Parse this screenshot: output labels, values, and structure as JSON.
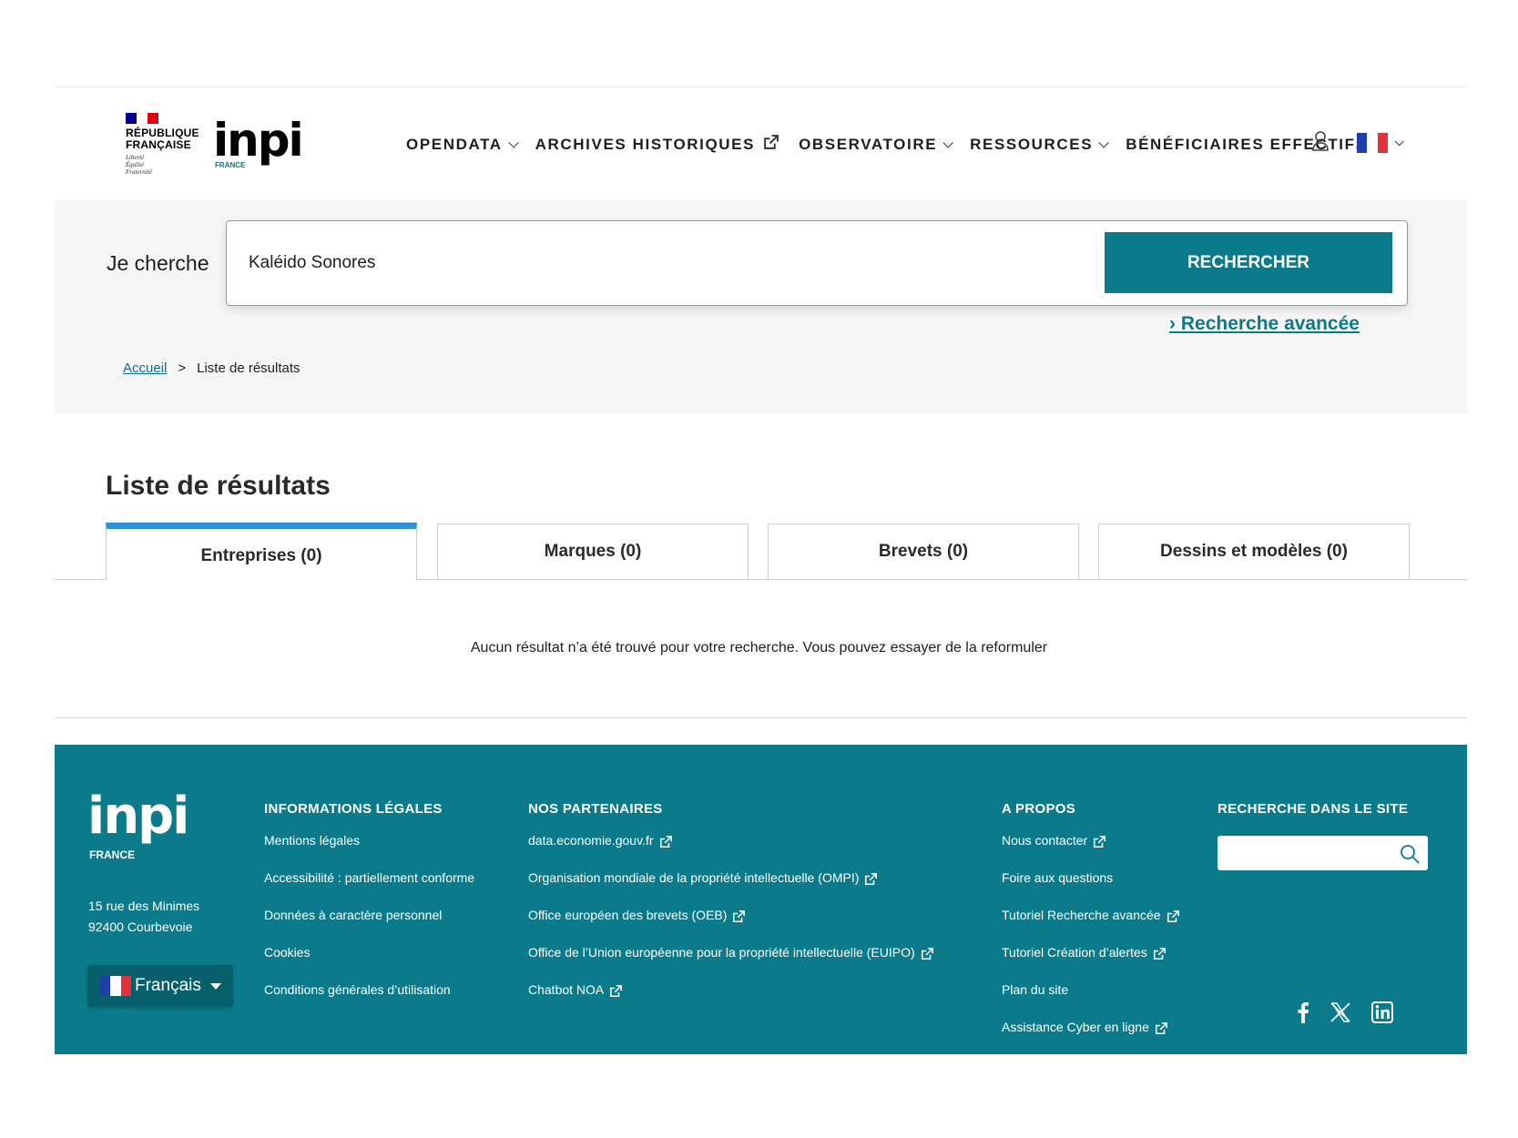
{
  "header": {
    "gov": {
      "line1": "RÉPUBLIQUE",
      "line2": "FRANÇAISE",
      "motto1": "Liberté",
      "motto2": "Égalité",
      "motto3": "Fraternité",
      "flag_colors": [
        "#000091",
        "#ffffff",
        "#e1000f"
      ]
    },
    "logo": {
      "word": "inpi",
      "sub": "FRANCE"
    },
    "nav": [
      {
        "label": "OPENDATA",
        "icon": "chevron-down-icon"
      },
      {
        "label": "ARCHIVES HISTORIQUES",
        "icon": "external-link-icon"
      },
      {
        "label": "OBSERVATOIRE",
        "icon": "chevron-down-icon"
      },
      {
        "label": "RESSOURCES",
        "icon": "chevron-down-icon"
      },
      {
        "label": "BÉNÉFICIAIRES EFFECTIFS",
        "icon": ""
      }
    ],
    "user_icon": "user-icon",
    "language_flag": "french-flag-icon"
  },
  "search": {
    "label": "Je cherche",
    "value": "Kaléido Sonores",
    "button": "RECHERCHER",
    "advanced_link": "Recherche avancée",
    "advanced_prefix": "›"
  },
  "breadcrumb": {
    "home": "Accueil",
    "separator": ">",
    "current": "Liste de résultats"
  },
  "results": {
    "title": "Liste de résultats",
    "tabs": [
      {
        "label": "Entreprises (0)",
        "active": true
      },
      {
        "label": "Marques (0)",
        "active": false
      },
      {
        "label": "Brevets (0)",
        "active": false
      },
      {
        "label": "Dessins et modèles (0)",
        "active": false
      }
    ],
    "empty_message": "Aucun résultat n’a été trouvé pour votre recherche. Vous pouvez essayer de la reformuler"
  },
  "footer": {
    "logo": {
      "word": "inpi",
      "sub": "FRANCE"
    },
    "address_line1": "15 rue des Minimes",
    "address_line2": "92400 Courbevoie",
    "language": "Français",
    "columns": [
      {
        "title": "INFORMATIONS LÉGALES",
        "links": [
          {
            "label": "Mentions légales",
            "external": false
          },
          {
            "label": "Accessibilité : partiellement conforme",
            "external": false
          },
          {
            "label": "Données à caractère personnel",
            "external": false
          },
          {
            "label": "Cookies",
            "external": false
          },
          {
            "label": "Conditions générales d’utilisation",
            "external": false
          }
        ]
      },
      {
        "title": "NOS PARTENAIRES",
        "links": [
          {
            "label": "data.economie.gouv.fr",
            "external": true
          },
          {
            "label": "Organisation mondiale de la propriété intellectuelle (OMPI)",
            "external": true
          },
          {
            "label": "Office européen des brevets (OEB)",
            "external": true
          },
          {
            "label": "Office de l’Union européenne pour la propriété intellectuelle (EUIPO)",
            "external": true
          },
          {
            "label": "Chatbot NOA",
            "external": true
          }
        ]
      },
      {
        "title": "A PROPOS",
        "links": [
          {
            "label": "Nous contacter",
            "external": true
          },
          {
            "label": "Foire aux questions",
            "external": false
          },
          {
            "label": "Tutoriel Recherche avancée",
            "external": true
          },
          {
            "label": "Tutoriel Création d’alertes",
            "external": true
          },
          {
            "label": "Plan du site",
            "external": false
          },
          {
            "label": "Assistance Cyber en ligne",
            "external": true
          }
        ]
      }
    ],
    "site_search": {
      "title": "RECHERCHE DANS LE SITE",
      "value": "",
      "icon": "search-icon"
    },
    "socials": [
      "facebook-icon",
      "x-twitter-icon",
      "linkedin-icon"
    ]
  },
  "colors": {
    "primary": "#0b7a8a",
    "active_tab": "#2b91d9",
    "band": "#f6f6f6"
  }
}
